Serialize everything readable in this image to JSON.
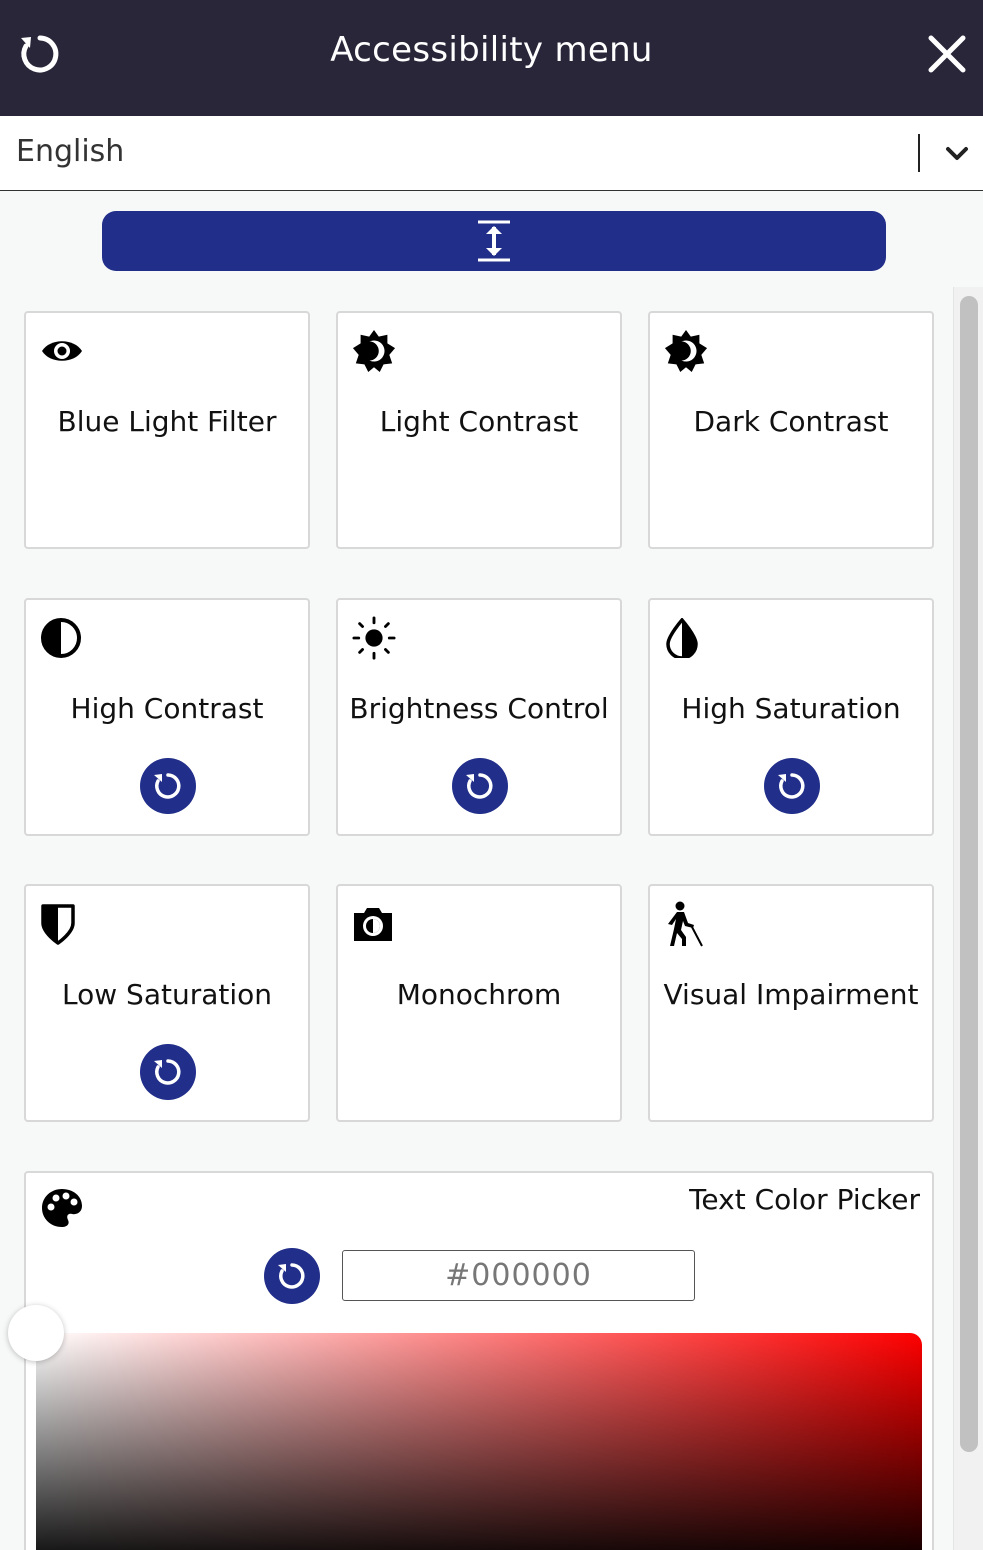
{
  "header": {
    "title": "Accessibility menu",
    "reset_icon": "reset-icon",
    "close_icon": "close-icon",
    "bg_color": "#29263a"
  },
  "language": {
    "selected": "English",
    "chevron_icon": "chevron-down-icon"
  },
  "collapse_bar": {
    "icon": "vertical-resize-icon",
    "color": "#212e8a"
  },
  "cards": [
    {
      "label": "Blue Light Filter",
      "icon": "eye-icon",
      "has_reset": false
    },
    {
      "label": "Light Contrast",
      "icon": "light-contrast-icon",
      "has_reset": false
    },
    {
      "label": "Dark Contrast",
      "icon": "dark-contrast-icon",
      "has_reset": false
    },
    {
      "label": "High Contrast",
      "icon": "half-circle-icon",
      "has_reset": true
    },
    {
      "label": "Brightness Control",
      "icon": "sun-icon",
      "has_reset": true
    },
    {
      "label": "High Saturation",
      "icon": "drop-half-icon",
      "has_reset": true
    },
    {
      "label": "Low Saturation",
      "icon": "drop-low-icon",
      "has_reset": true
    },
    {
      "label": "Monochrom",
      "icon": "camera-icon",
      "has_reset": false
    },
    {
      "label": "Visual Impairment",
      "icon": "blind-walker-icon",
      "has_reset": false
    }
  ],
  "color_picker": {
    "title": "Text Color Picker",
    "icon": "palette-icon",
    "hex_value": "#000000",
    "hue": "#ff0000"
  },
  "accent_color": "#212e8a"
}
